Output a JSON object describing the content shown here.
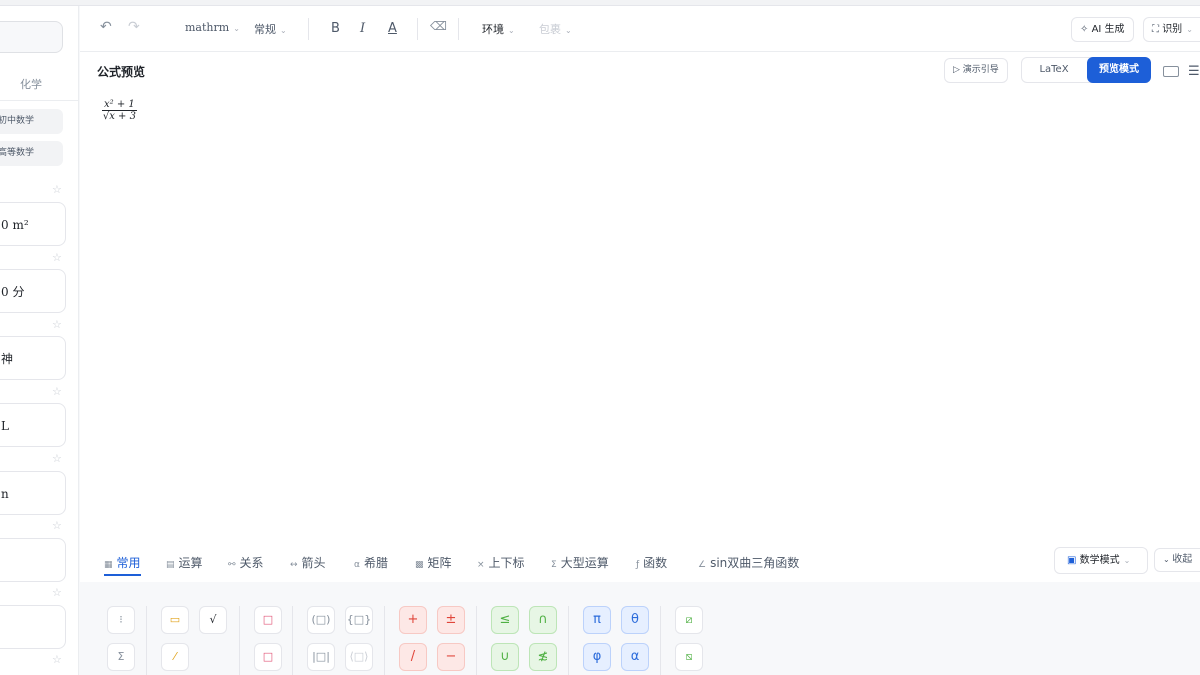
{
  "sidebar": {
    "tab_label": "化学",
    "categories": [
      "初中数学",
      "高等数学"
    ],
    "cards": [
      "0 m²",
      "0 分",
      "神",
      "L",
      "n",
      "",
      ""
    ]
  },
  "toolbar": {
    "undo_icon": "↶",
    "redo_icon": "↷",
    "font_value": "mathrm",
    "style_value": "常规",
    "bold": "B",
    "italic": "I",
    "color_letter": "A",
    "eraser_icon": "⌫",
    "env_label": "环境",
    "wrap_label": "包裹",
    "ai_label": "AI 生成",
    "recognize_label": "识别"
  },
  "preview": {
    "title": "公式预览",
    "demo_label": "演示引导",
    "latex_label": "LaTeX",
    "preview_mode_label": "预览模式",
    "formula": {
      "numerator": "x² + 1",
      "denominator": "x + 3"
    }
  },
  "panel": {
    "tabs": [
      {
        "icon": "▦",
        "label": "常用"
      },
      {
        "icon": "▤",
        "label": "运算"
      },
      {
        "icon": "⚯",
        "label": "关系"
      },
      {
        "icon": "↔",
        "label": "箭头"
      },
      {
        "icon": "α",
        "label": "希腊"
      },
      {
        "icon": "▩",
        "label": "矩阵"
      },
      {
        "icon": "×",
        "label": "上下标"
      },
      {
        "icon": "Σ",
        "label": "大型运算"
      },
      {
        "icon": "ƒ",
        "label": "函数"
      },
      {
        "icon": "∠",
        "label": "sin双曲三角函数"
      }
    ],
    "active_tab": "常用",
    "mode_label": "数学模式",
    "collapse_label": "收起",
    "symbols": {
      "red": [
        "+",
        "±",
        "/",
        "−"
      ],
      "green": [
        "≤",
        "∩",
        "∪",
        "≴"
      ],
      "blue": [
        "π",
        "θ",
        "φ",
        "α"
      ]
    }
  },
  "colors": {
    "accent": "#1d5fd8",
    "red_sym": "#e0453a",
    "green_sym": "#4fb043",
    "blue_sym": "#2b6bdb"
  }
}
